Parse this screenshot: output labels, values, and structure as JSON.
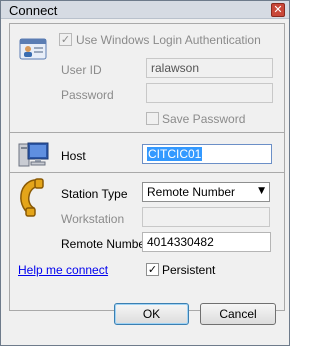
{
  "window": {
    "title": "Connect",
    "close_glyph": "✕"
  },
  "login": {
    "use_windows_auth_label": "Use Windows Login Authentication",
    "use_windows_auth_checked": "✓",
    "user_id_label": "User ID",
    "user_id_value": "ralawson",
    "password_label": "Password",
    "password_value": "",
    "save_password_label": "Save Password"
  },
  "host": {
    "label": "Host",
    "value": "CITCIC01"
  },
  "station": {
    "type_label": "Station Type",
    "type_value": "Remote Number",
    "workstation_label": "Workstation",
    "workstation_value": "",
    "remote_number_label": "Remote Number",
    "remote_number_value": "4014330482"
  },
  "footer": {
    "help_link": "Help me connect",
    "persistent_label": "Persistent",
    "persistent_checked": "✓",
    "ok_label": "OK",
    "cancel_label": "Cancel"
  },
  "icons": {
    "id_card": "id-card-icon",
    "computer": "computer-icon",
    "phone": "phone-icon",
    "dropdown": "▼"
  }
}
